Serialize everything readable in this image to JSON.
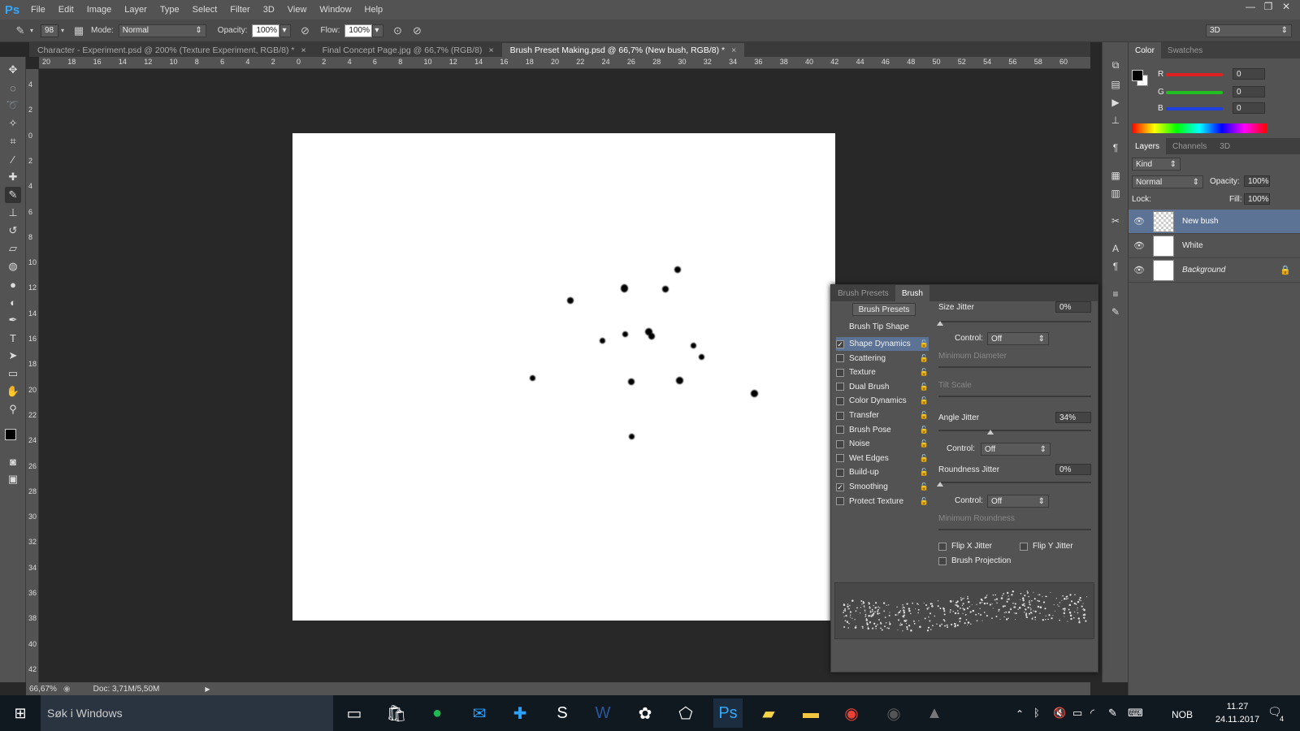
{
  "app": {
    "logo": "Ps"
  },
  "menu": [
    "File",
    "Edit",
    "Image",
    "Layer",
    "Type",
    "Select",
    "Filter",
    "3D",
    "View",
    "Window",
    "Help"
  ],
  "window_controls": {
    "minimize": "—",
    "restore": "❐",
    "close": "✕"
  },
  "options_bar": {
    "brush_size": "98",
    "mode_label": "Mode:",
    "mode_value": "Normal",
    "opacity_label": "Opacity:",
    "opacity_value": "100%",
    "flow_label": "Flow:",
    "flow_value": "100%",
    "workspace_value": "3D"
  },
  "doc_tabs": [
    {
      "label": "Character - Experiment.psd @ 200% (Texture Experiment, RGB/8) *",
      "close": "×"
    },
    {
      "label": "Final Concept Page.jpg @ 66,7% (RGB/8)",
      "close": "×"
    },
    {
      "label": "Brush Preset Making.psd @ 66,7% (New bush, RGB/8) *",
      "close": "×"
    }
  ],
  "hruler": [
    "20",
    "18",
    "16",
    "14",
    "12",
    "10",
    "8",
    "6",
    "4",
    "2",
    "0",
    "2",
    "4",
    "6",
    "8",
    "10",
    "12",
    "14",
    "16",
    "18",
    "20",
    "22",
    "24",
    "26",
    "28",
    "30",
    "32",
    "34",
    "36",
    "38",
    "40",
    "42",
    "44",
    "46",
    "48",
    "50",
    "52",
    "54",
    "56",
    "58",
    "60"
  ],
  "vruler": [
    "4",
    "2",
    "0",
    "2",
    "4",
    "6",
    "8",
    "10",
    "12",
    "14",
    "16",
    "18",
    "20",
    "22",
    "24",
    "26",
    "28",
    "30",
    "32",
    "34",
    "36",
    "38",
    "40",
    "42"
  ],
  "status": {
    "zoom": "66,67%",
    "doc": "Doc: 3,71M/5,50M",
    "arrow": "▶"
  },
  "color_panel": {
    "tabs": [
      "Color",
      "Swatches"
    ],
    "r_label": "R",
    "g_label": "G",
    "b_label": "B",
    "r": "0",
    "g": "0",
    "b": "0",
    "colors": {
      "r": "#e02020",
      "g": "#20c020",
      "b": "#2040e0"
    }
  },
  "layers_panel": {
    "tabs": [
      "Layers",
      "Channels",
      "3D"
    ],
    "kind": "Kind",
    "blend": "Normal",
    "opacity_label": "Opacity:",
    "opacity": "100%",
    "lock_label": "Lock:",
    "fill_label": "Fill:",
    "fill": "100%",
    "layers": [
      {
        "name": "New bush",
        "selected": true
      },
      {
        "name": "White",
        "selected": false
      },
      {
        "name": "Background",
        "selected": false,
        "locked": true
      }
    ]
  },
  "brush_panel": {
    "tabs": [
      "Brush Presets",
      "Brush"
    ],
    "presets_button": "Brush Presets",
    "tip_shape": "Brush Tip Shape",
    "options": [
      {
        "label": "Shape Dynamics",
        "checked": true
      },
      {
        "label": "Scattering",
        "checked": false
      },
      {
        "label": "Texture",
        "checked": false
      },
      {
        "label": "Dual Brush",
        "checked": false
      },
      {
        "label": "Color Dynamics",
        "checked": false
      },
      {
        "label": "Transfer",
        "checked": false
      },
      {
        "label": "Brush Pose",
        "checked": false
      },
      {
        "label": "Noise",
        "checked": false
      },
      {
        "label": "Wet Edges",
        "checked": false
      },
      {
        "label": "Build-up",
        "checked": false
      },
      {
        "label": "Smoothing",
        "checked": true
      },
      {
        "label": "Protect Texture",
        "checked": false
      }
    ],
    "size_jitter_label": "Size Jitter",
    "size_jitter": "0%",
    "control_label": "Control:",
    "control_1": "Off",
    "min_diameter": "Minimum Diameter",
    "tilt_scale": "Tilt Scale",
    "angle_jitter_label": "Angle Jitter",
    "angle_jitter": "34%",
    "control_2": "Off",
    "roundness_jitter_label": "Roundness Jitter",
    "roundness_jitter": "0%",
    "control_3": "Off",
    "min_roundness": "Minimum Roundness",
    "flip_x": "Flip X Jitter",
    "flip_y": "Flip Y Jitter",
    "brush_projection": "Brush Projection"
  },
  "taskbar": {
    "search": "Søk i Windows",
    "lang": "NOB",
    "time": "11.27",
    "date": "24.11.2017",
    "notif": "4"
  }
}
